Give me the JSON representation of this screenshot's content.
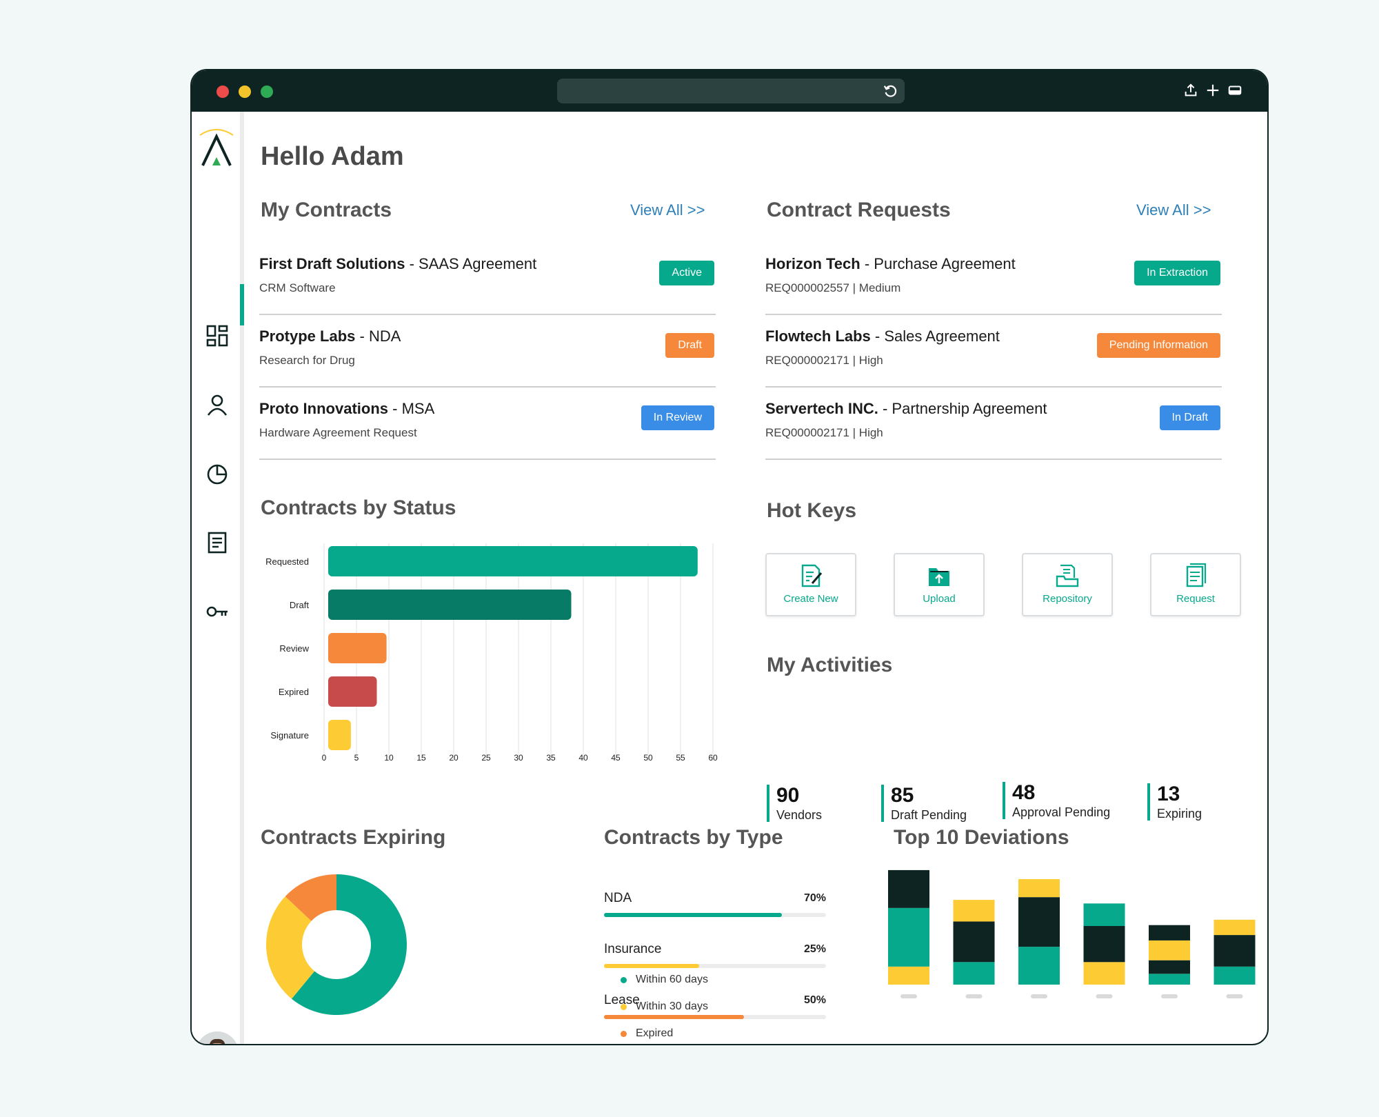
{
  "greeting": "Hello Adam",
  "colors": {
    "teal": "#07a98d",
    "dark_teal": "#087b66",
    "orange": "#f5883a",
    "red": "#c74b4b",
    "yellow": "#fdcb34",
    "blue": "#3a8de6",
    "dark": "#0d2422"
  },
  "sidebar": {
    "icons": [
      "dashboard-icon",
      "user-icon",
      "pie-chart-icon",
      "document-icon",
      "key-icon"
    ]
  },
  "my_contracts": {
    "title": "My Contracts",
    "view_all": "View All  >>",
    "items": [
      {
        "company": "First Draft Solutions",
        "type": "SAAS Agreement",
        "sub": "CRM Software",
        "status": "Active",
        "status_color": "#07a98d"
      },
      {
        "company": "Protype Labs",
        "type": "NDA",
        "sub": "Research for Drug",
        "status": "Draft",
        "status_color": "#f5883a"
      },
      {
        "company": "Proto Innovations",
        "type": "MSA",
        "sub": "Hardware Agreement Request",
        "status": "In Review",
        "status_color": "#3a8de6"
      }
    ]
  },
  "contract_requests": {
    "title": "Contract Requests",
    "view_all": "View All  >>",
    "items": [
      {
        "company": "Horizon Tech",
        "type": "Purchase Agreement",
        "sub": "REQ000002557  |  Medium",
        "status": "In Extraction",
        "status_color": "#07a98d"
      },
      {
        "company": "Flowtech Labs",
        "type": "Sales Agreement",
        "sub": "REQ000002171  |  High",
        "status": "Pending Information",
        "status_color": "#f5883a"
      },
      {
        "company": "Servertech INC.",
        "type": "Partnership Agreement",
        "sub": "REQ000002171  |  High",
        "status": "In Draft",
        "status_color": "#3a8de6"
      }
    ]
  },
  "status_chart": {
    "title": "Contracts by Status",
    "chart_data": {
      "type": "bar",
      "orientation": "horizontal",
      "categories": [
        "Requested",
        "Draft",
        "Review",
        "Expired",
        "Signature"
      ],
      "values": [
        57,
        37.5,
        9,
        7.5,
        3.5
      ],
      "colors": [
        "#07a98d",
        "#087b66",
        "#f5883a",
        "#c74b4b",
        "#fdcb34"
      ],
      "x_ticks": [
        "0",
        "5",
        "10",
        "15",
        "20",
        "25",
        "30",
        "35",
        "40",
        "45",
        "50",
        "55",
        "60"
      ],
      "xlim": [
        0,
        60
      ],
      "grid": true
    }
  },
  "hot_keys": {
    "title": "Hot Keys",
    "items": [
      {
        "label": "Create New",
        "icon": "create-new-icon"
      },
      {
        "label": "Upload",
        "icon": "upload-icon"
      },
      {
        "label": "Repository",
        "icon": "repository-icon"
      },
      {
        "label": "Request",
        "icon": "request-icon"
      }
    ]
  },
  "my_activities": {
    "title": "My Activities",
    "items": [
      {
        "value": "90",
        "label": "Vendors"
      },
      {
        "value": "85",
        "label": "Draft Pending"
      },
      {
        "value": "48",
        "label": "Approval Pending"
      },
      {
        "value": "13",
        "label": "Expiring"
      }
    ]
  },
  "expiring": {
    "title": "Contracts Expiring",
    "chart_data": {
      "type": "pie",
      "donut": true,
      "labels": [
        "Within 60 days",
        "Within 30 days",
        "Expired"
      ],
      "values": [
        61,
        26,
        13
      ],
      "colors": [
        "#07a98d",
        "#fdcb34",
        "#f5883a"
      ],
      "legend": "right"
    }
  },
  "by_type": {
    "title": "Contracts by Type",
    "items": [
      {
        "label": "NDA",
        "value_text": "70%",
        "value": 0.8,
        "color": "#07a98d"
      },
      {
        "label": "Insurance",
        "value_text": "25%",
        "value": 0.43,
        "color": "#fdcb34"
      },
      {
        "label": "Lease",
        "value_text": "50%",
        "value": 0.63,
        "color": "#f5883a"
      }
    ]
  },
  "deviations": {
    "title": "Top 10 Deviations",
    "chart_data": {
      "type": "bar",
      "stacked": true,
      "categories": [
        "",
        "",
        "",
        "",
        "",
        ""
      ],
      "series": [
        {
          "color": "#fdcb34",
          "values": [
            20,
            0,
            0,
            25,
            0,
            0
          ]
        },
        {
          "color": "#07a98d",
          "values": [
            65,
            25,
            42,
            0,
            12,
            20
          ]
        },
        {
          "color": "#0d2422",
          "values": [
            42,
            45,
            55,
            40,
            15,
            35
          ]
        },
        {
          "color": "#fdcb34",
          "values": [
            0,
            24,
            20,
            0,
            22,
            17
          ]
        },
        {
          "color": "#07a98d",
          "values": [
            0,
            0,
            0,
            25,
            0,
            0
          ]
        },
        {
          "color": "#0d2422",
          "values": [
            0,
            0,
            0,
            0,
            17,
            0
          ]
        }
      ],
      "ylim": [
        0,
        130
      ]
    }
  }
}
